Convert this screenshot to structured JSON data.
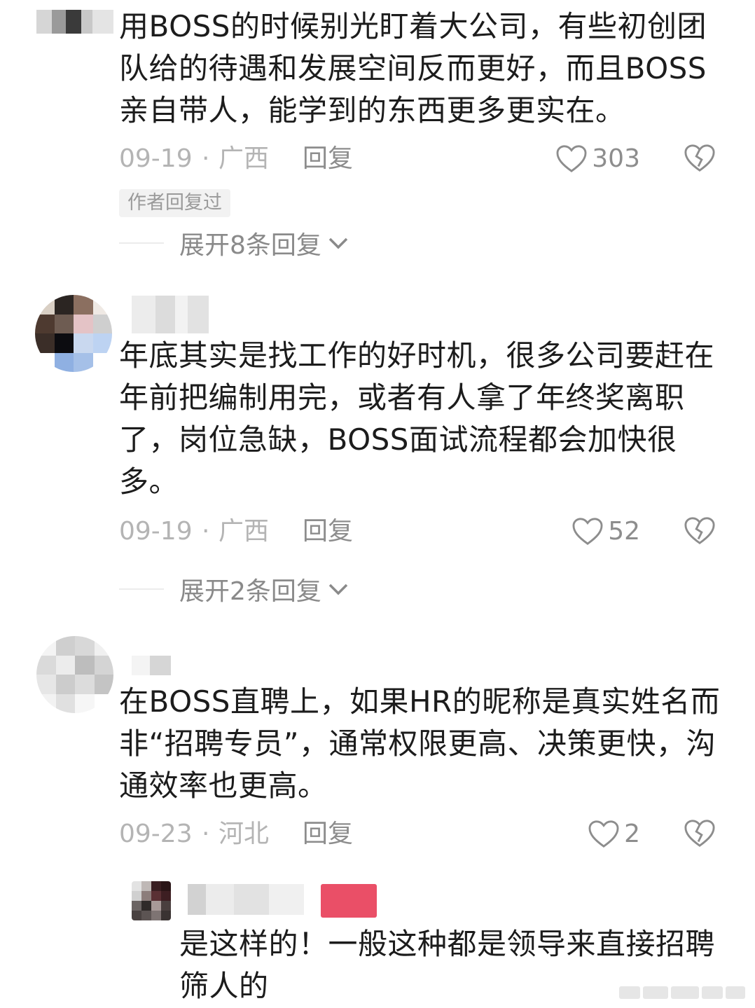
{
  "comments": [
    {
      "text_lines": [
        "用BOSS的时候别光盯着大公司，有些初创团",
        "队给的待遇和发展空间反而更好，而且BOSS",
        "亲自带人，能学到的东西更多更实在。"
      ],
      "date": "09-19",
      "separator": "·",
      "region": "广西",
      "reply_label": "回复",
      "likes": "303",
      "author_tag": "作者回复过",
      "expand_label": "展开8条回复",
      "avatar_icon": "blurred-avatar-icon",
      "like_icon": "heart-outline-icon",
      "dislike_icon": "broken-heart-icon",
      "expand_icon": "chevron-down-icon"
    },
    {
      "text_lines": [
        "年底其实是找工作的好时机，很多公司要赶在",
        "年前把编制用完，或者有人拿了年终奖离职",
        "了，岗位急缺，BOSS面试流程都会加快很",
        "多。"
      ],
      "date": "09-19",
      "separator": "·",
      "region": "广西",
      "reply_label": "回复",
      "likes": "52",
      "expand_label": "展开2条回复"
    },
    {
      "text_lines": [
        "在BOSS直聘上，如果HR的昵称是真实姓名而",
        "非“招聘专员”，通常权限更高、决策更快，沟",
        "通效率也更高。"
      ],
      "date": "09-23",
      "separator": "·",
      "region": "河北",
      "reply_label": "回复",
      "likes": "2"
    }
  ],
  "reply": {
    "text_lines": [
      "是这样的！一般这种都是领导来直接招聘",
      "筛人的"
    ]
  },
  "colors": {
    "text": "#1c1c1c",
    "meta": "#b4b4b4",
    "accent_badge": "#e8405a"
  }
}
